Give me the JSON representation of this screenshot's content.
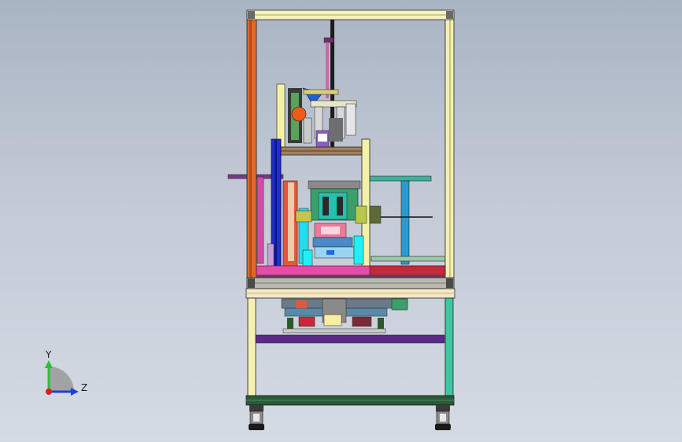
{
  "viewport": {
    "colors": {
      "background_top": "#a9b4c3",
      "background_bottom": "#d5dbe4"
    }
  },
  "model": {
    "icon": "cad-machine-assembly-front-view"
  },
  "triad": {
    "y_label": "Y",
    "z_label": "Z",
    "colors": {
      "y_axis": "#2bbf3a",
      "z_axis": "#1f3fd6",
      "origin": "#d61f1f"
    }
  }
}
